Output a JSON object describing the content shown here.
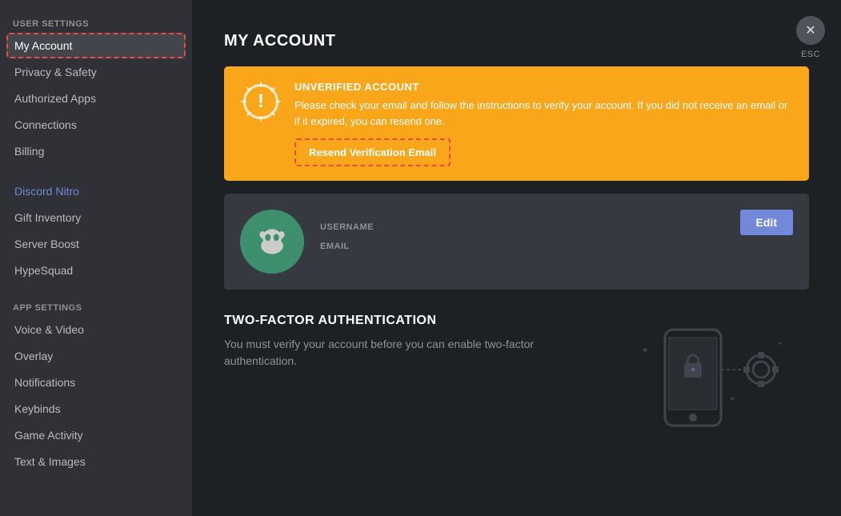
{
  "sidebar": {
    "user_settings_label": "USER SETTINGS",
    "app_settings_label": "APP SETTINGS",
    "items_user": [
      {
        "id": "my-account",
        "label": "My Account",
        "active": true,
        "nitro": false
      },
      {
        "id": "privacy-safety",
        "label": "Privacy & Safety",
        "active": false,
        "nitro": false
      },
      {
        "id": "authorized-apps",
        "label": "Authorized Apps",
        "active": false,
        "nitro": false
      },
      {
        "id": "connections",
        "label": "Connections",
        "active": false,
        "nitro": false
      },
      {
        "id": "billing",
        "label": "Billing",
        "active": false,
        "nitro": false
      }
    ],
    "items_nitro": [
      {
        "id": "discord-nitro",
        "label": "Discord Nitro",
        "active": false,
        "nitro": true
      },
      {
        "id": "gift-inventory",
        "label": "Gift Inventory",
        "active": false,
        "nitro": false
      },
      {
        "id": "server-boost",
        "label": "Server Boost",
        "active": false,
        "nitro": false
      },
      {
        "id": "hypesquad",
        "label": "HypeSquad",
        "active": false,
        "nitro": false
      }
    ],
    "items_app": [
      {
        "id": "voice-video",
        "label": "Voice & Video",
        "active": false,
        "nitro": false
      },
      {
        "id": "overlay",
        "label": "Overlay",
        "active": false,
        "nitro": false
      },
      {
        "id": "notifications",
        "label": "Notifications",
        "active": false,
        "nitro": false
      },
      {
        "id": "keybinds",
        "label": "Keybinds",
        "active": false,
        "nitro": false
      },
      {
        "id": "game-activity",
        "label": "Game Activity",
        "active": false,
        "nitro": false
      },
      {
        "id": "text-images",
        "label": "Text & Images",
        "active": false,
        "nitro": false
      }
    ]
  },
  "main": {
    "page_title": "MY ACCOUNT",
    "banner": {
      "title": "UNVERIFIED ACCOUNT",
      "description": "Please check your email and follow the instructions to verify your account. If you did not receive an email or if it expired, you can resend one.",
      "resend_button": "Resend Verification Email"
    },
    "account": {
      "username_label": "USERNAME",
      "username_value": "",
      "email_label": "EMAIL",
      "email_value": "",
      "edit_button": "Edit"
    },
    "tfa": {
      "title": "TWO-FACTOR AUTHENTICATION",
      "description": "You must verify your account before you can enable two-factor authentication."
    }
  },
  "esc": {
    "label": "ESC"
  }
}
